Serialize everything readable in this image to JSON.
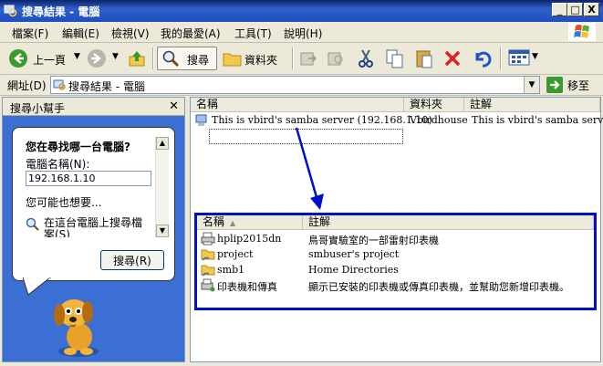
{
  "window": {
    "title": "搜尋結果 - 電腦",
    "caption_buttons": [
      "_",
      "□",
      "X"
    ]
  },
  "menu": {
    "items": [
      "檔案(F)",
      "編輯(E)",
      "檢視(V)",
      "我的最愛(A)",
      "工具(T)",
      "說明(H)"
    ]
  },
  "toolbar": {
    "back_label": "上一頁",
    "search_label": "搜尋",
    "folders_label": "資料夾"
  },
  "address": {
    "label": "網址(D)",
    "value": "搜尋結果 - 電腦",
    "go_label": "移至"
  },
  "search_pane": {
    "title": "搜尋小幫手",
    "question": "您在尋找哪一台電腦?",
    "field_label": "電腦名稱(N):",
    "field_value": "192.168.1.10",
    "maybe_text": "您可能也想要...",
    "option_text": "在這台電腦上搜尋檔案(S)",
    "search_button": "搜尋(R)"
  },
  "results": {
    "columns": [
      "名稱",
      "資料夾",
      "註解"
    ],
    "row": {
      "name": "This is vbird's samba server (192.168.1.10)",
      "folder": "Vbirdhouse",
      "comment": "This is vbird's samba server"
    }
  },
  "shares": {
    "columns": [
      "名稱",
      "註解"
    ],
    "items": [
      {
        "name": "hplip2015dn",
        "comment": "鳥哥實驗室的一部雷射印表機",
        "icon": "printer-icon"
      },
      {
        "name": "project",
        "comment": "smbuser's project",
        "icon": "folder-share-icon"
      },
      {
        "name": "smb1",
        "comment": "Home Directories",
        "icon": "folder-share-icon"
      },
      {
        "name": "印表機和傳真",
        "comment": "顯示已安裝的印表機或傳真印表機，並幫助您新增印表機。",
        "icon": "printers-faxes-icon"
      }
    ]
  },
  "colors": {
    "title_bar": "#1e4fbf",
    "task_pane": "#3c6fd3",
    "highlight_box": "#0010c8"
  }
}
